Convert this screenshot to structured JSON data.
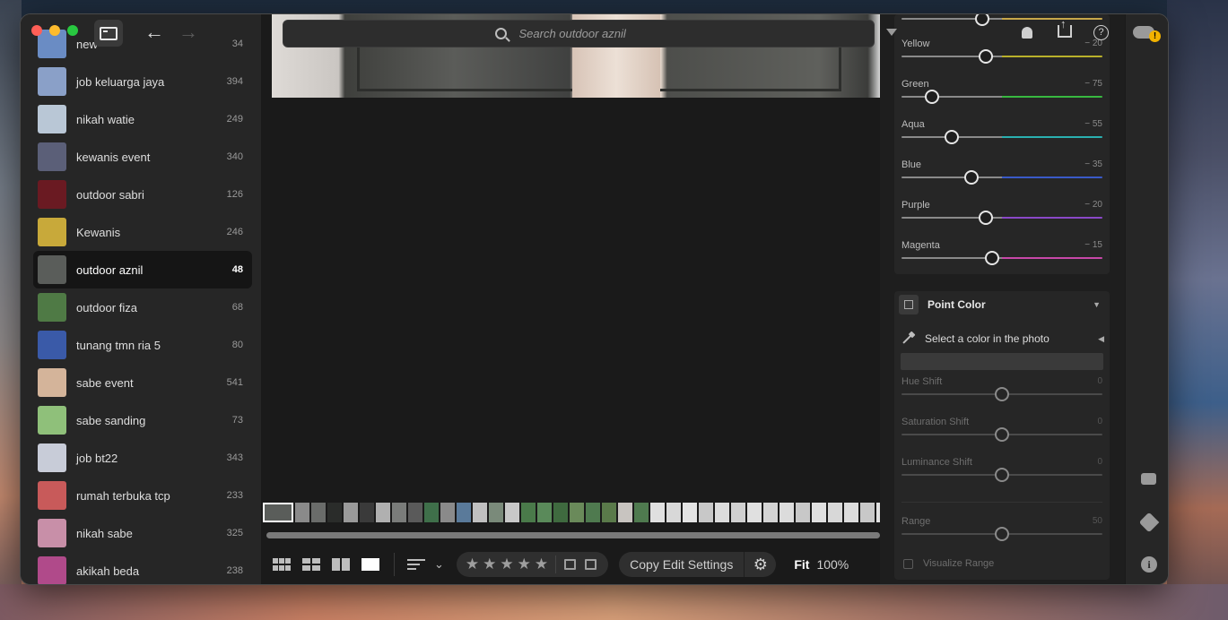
{
  "sidebar": {
    "albums": [
      {
        "name": "new",
        "count": "34",
        "thumb": "#6a8cc4"
      },
      {
        "name": "job keluarga jaya",
        "count": "394",
        "thumb": "#8aa0c8"
      },
      {
        "name": "nikah watie",
        "count": "249",
        "thumb": "#b9c7d6"
      },
      {
        "name": "kewanis event",
        "count": "340",
        "thumb": "#5b5f78"
      },
      {
        "name": "outdoor sabri",
        "count": "126",
        "thumb": "#6a1a22"
      },
      {
        "name": "Kewanis",
        "count": "246",
        "thumb": "#c8a93a"
      },
      {
        "name": "outdoor aznil",
        "count": "48",
        "thumb": "#5a5d5a"
      },
      {
        "name": "outdoor fiza",
        "count": "68",
        "thumb": "#4f7a45"
      },
      {
        "name": "tunang tmn ria 5",
        "count": "80",
        "thumb": "#3a5aa8"
      },
      {
        "name": "sabe event",
        "count": "541",
        "thumb": "#d4b49a"
      },
      {
        "name": "sabe sanding",
        "count": "73",
        "thumb": "#8fc07a"
      },
      {
        "name": "job bt22",
        "count": "343",
        "thumb": "#c8ccd8"
      },
      {
        "name": "rumah terbuka tcp",
        "count": "233",
        "thumb": "#c85a5a"
      },
      {
        "name": "nikah sabe",
        "count": "325",
        "thumb": "#c88fa8"
      },
      {
        "name": "akikah beda",
        "count": "238",
        "thumb": "#b04a8a"
      }
    ]
  },
  "search": {
    "placeholder": "Search outdoor aznil"
  },
  "bottombar": {
    "copy_label": "Copy Edit Settings",
    "fit_label": "Fit",
    "zoom_label": "100%",
    "rating_stars": 5
  },
  "mix_sliders": [
    {
      "label": "",
      "value": "",
      "position": 0.4,
      "color": "#c8a84a",
      "dim": false
    },
    {
      "label": "Yellow",
      "value": "− 20",
      "position": 0.42,
      "color": "#b8b02a",
      "dim": false
    },
    {
      "label": "Green",
      "value": "− 75",
      "position": 0.15,
      "color": "#38b840",
      "dim": false
    },
    {
      "label": "Aqua",
      "value": "− 55",
      "position": 0.25,
      "color": "#2ab0b0",
      "dim": false
    },
    {
      "label": "Blue",
      "value": "− 35",
      "position": 0.35,
      "color": "#3a5ac8",
      "dim": false
    },
    {
      "label": "Purple",
      "value": "− 20",
      "position": 0.42,
      "color": "#8a48c8",
      "dim": false
    },
    {
      "label": "Magenta",
      "value": "− 15",
      "position": 0.45,
      "color": "#c848a8",
      "dim": false
    }
  ],
  "point_color": {
    "title": "Point Color",
    "select_label": "Select a color in the photo",
    "sliders": [
      {
        "label": "Hue Shift",
        "value": "0",
        "position": 0.5,
        "dim": true
      },
      {
        "label": "Saturation Shift",
        "value": "0",
        "position": 0.5,
        "dim": true
      },
      {
        "label": "Luminance Shift",
        "value": "0",
        "position": 0.5,
        "dim": true
      },
      {
        "label": "Range",
        "value": "50",
        "position": 0.5,
        "dim": true
      }
    ],
    "visualize_label": "Visualize Range"
  },
  "filmstrip": {
    "colors": [
      "#5a5d5a",
      "#8a8a8a",
      "#6a6c6a",
      "#2a2c2a",
      "#9a9a9a",
      "#3a3a3a",
      "#b0b0b0",
      "#7a7c7a",
      "#5a5a5a",
      "#3f6f4a",
      "#8a8a8a",
      "#5a7a9a",
      "#c0c0c0",
      "#7a8a7a",
      "#c8c8c8",
      "#4a7a4a",
      "#5a8a5a",
      "#3f6a3f",
      "#6a8a5a",
      "#4f7a4f",
      "#5a7a4a",
      "#c8c4c0",
      "#4f7a4f",
      "#e0e0e0",
      "#d8d8d8",
      "#e4e4e4",
      "#c8c8c8",
      "#dcdcdc",
      "#d0d0d0",
      "#e0e0e0",
      "#d4d4d4",
      "#dcdcdc",
      "#c8c8c8",
      "#e0e0e0",
      "#d8d8d8",
      "#dcdcdc",
      "#c8c8c8",
      "#e0e0e0"
    ]
  }
}
